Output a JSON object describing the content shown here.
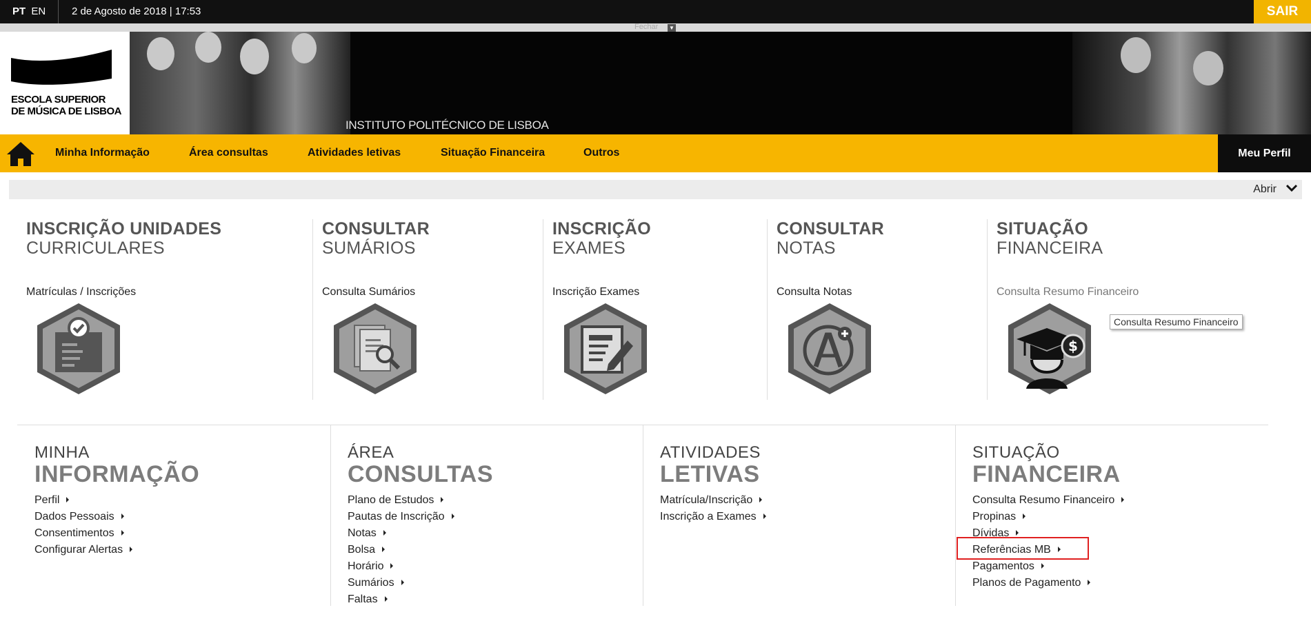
{
  "topbar": {
    "lang_pt": "PT",
    "lang_en": "EN",
    "datetime": "2 de Agosto de 2018 | 17:53",
    "logout": "SAIR"
  },
  "collapse": {
    "fechar": "Fechar"
  },
  "banner": {
    "logo_line1": "ESCOLA SUPERIOR",
    "logo_line2": "DE MÚSICA DE LISBOA",
    "institute": "INSTITUTO POLITÉCNICO DE LISBOA"
  },
  "nav": {
    "items": [
      "Minha Informação",
      "Área consultas",
      "Atividades letivas",
      "Situação Financeira",
      "Outros"
    ],
    "profile": "Meu Perfil",
    "accent": "#f7b500"
  },
  "abrir": "Abrir",
  "tiles": [
    {
      "title1": "INSCRIÇÃO UNIDADES",
      "title2": "CURRICULARES",
      "link": "Matrículas / Inscrições",
      "icon": "enrollment-check-icon"
    },
    {
      "title1": "CONSULTAR",
      "title2": "SUMÁRIOS",
      "link": "Consulta Sumários",
      "icon": "document-search-icon"
    },
    {
      "title1": "INSCRIÇÃO",
      "title2": "EXAMES",
      "link": "Inscrição Exames",
      "icon": "exam-edit-icon"
    },
    {
      "title1": "CONSULTAR",
      "title2": "NOTAS",
      "link": "Consulta Notas",
      "icon": "grade-a-plus-icon"
    },
    {
      "title1": "SITUAÇÃO",
      "title2": "FINANCEIRA",
      "link": "Consulta Resumo Financeiro",
      "icon": "graduate-money-icon"
    }
  ],
  "tooltip": "Consulta Resumo Financeiro",
  "sections": [
    {
      "title1": "MINHA",
      "title2": "INFORMAÇÃO",
      "items": [
        "Perfil",
        "Dados Pessoais",
        "Consentimentos",
        "Configurar Alertas"
      ]
    },
    {
      "title1": "ÁREA",
      "title2": "CONSULTAS",
      "items": [
        "Plano de Estudos",
        "Pautas de Inscrição",
        "Notas",
        "Bolsa",
        "Horário",
        "Sumários",
        "Faltas"
      ]
    },
    {
      "title1": "ATIVIDADES",
      "title2": "LETIVAS",
      "items": [
        "Matrícula/Inscrição",
        "Inscrição a Exames"
      ]
    },
    {
      "title1": "SITUAÇÃO",
      "title2": "FINANCEIRA",
      "items": [
        "Consulta Resumo Financeiro",
        "Propinas",
        "Dívidas",
        "Referências MB",
        "Pagamentos",
        "Planos de Pagamento"
      ]
    }
  ]
}
